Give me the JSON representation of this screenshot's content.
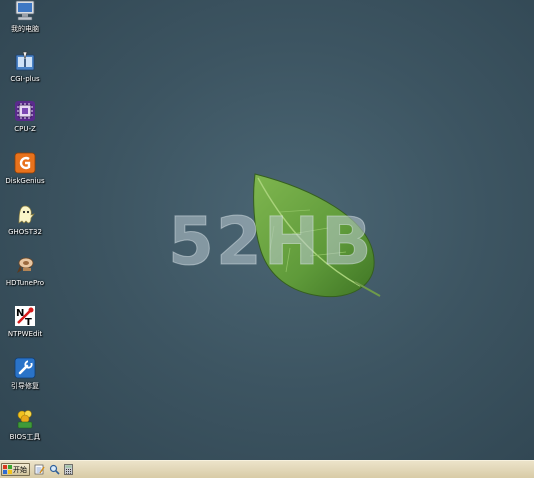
{
  "desktop_icons": [
    {
      "label": "我的电脑",
      "icon": "computer-icon"
    },
    {
      "label": "CGI-plus",
      "icon": "cgi-plus-icon"
    },
    {
      "label": "CPU-Z",
      "icon": "cpu-z-icon"
    },
    {
      "label": "DiskGenius",
      "icon": "diskgenius-icon"
    },
    {
      "label": "GHOST32",
      "icon": "ghost-icon"
    },
    {
      "label": "HDTunePro",
      "icon": "hdtune-icon"
    },
    {
      "label": "NTPWEdit",
      "icon": "ntpwedit-icon"
    },
    {
      "label": "引导修复",
      "icon": "boot-repair-icon"
    },
    {
      "label": "BIOS工具",
      "icon": "bios-tool-icon"
    }
  ],
  "wallpaper": {
    "logo_text": "52HB",
    "accent_color": "#5f9a3a"
  },
  "taskbar": {
    "start_label": "开始",
    "quick_launch": [
      "notepad-icon",
      "search-icon",
      "calculator-icon"
    ],
    "background_color": "#e4d9bb"
  }
}
